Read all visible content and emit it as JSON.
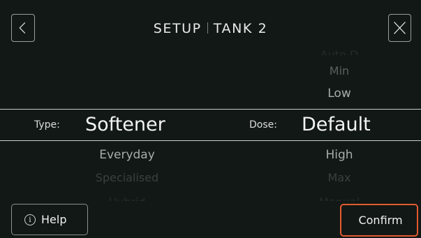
{
  "header": {
    "title_left": "SETUP",
    "title_right": "TANK 2",
    "back_icon": "chevron-left-icon",
    "close_icon": "close-icon"
  },
  "type_picker": {
    "label": "Type:",
    "selected": "Softener",
    "below": [
      "Everyday",
      "Specialised",
      "Hybrid"
    ]
  },
  "dose_picker": {
    "label": "Dose:",
    "above": [
      "Auto D",
      "Min",
      "Low"
    ],
    "selected": "Default",
    "below": [
      "High",
      "Max",
      "Manual"
    ]
  },
  "footer": {
    "help_label": "Help",
    "help_icon": "info-icon",
    "confirm_label": "Confirm"
  },
  "colors": {
    "background": "#121816",
    "confirm_border": "#e35b2f"
  }
}
